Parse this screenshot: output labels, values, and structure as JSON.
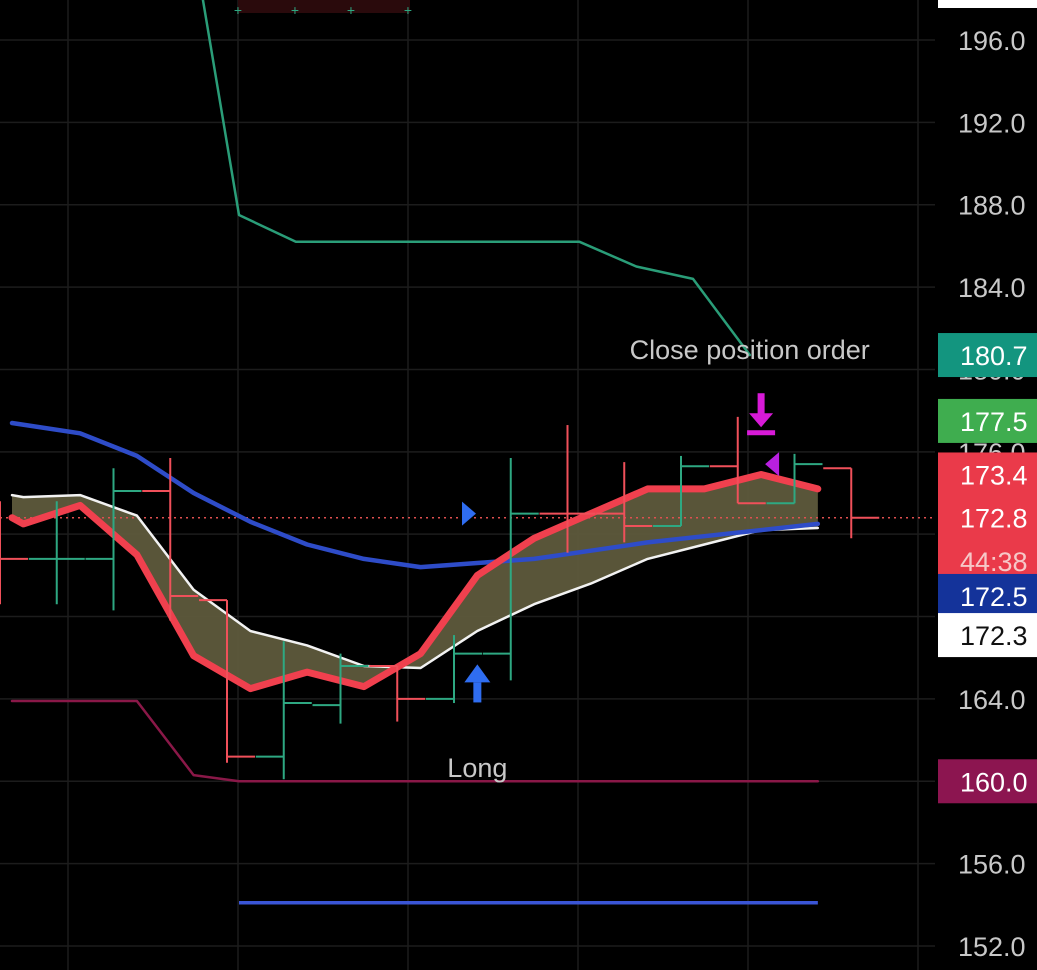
{
  "chart_data": {
    "type": "line",
    "ylim": [
      150.5,
      197.5
    ],
    "x_count": 15,
    "y_ticks": [
      {
        "value": 196,
        "label": "196.0"
      },
      {
        "value": 192,
        "label": "192.0"
      },
      {
        "value": 188,
        "label": "188.0"
      },
      {
        "value": 184,
        "label": "184.0"
      },
      {
        "value": 164,
        "label": "164.0"
      },
      {
        "value": 156,
        "label": "156.0"
      },
      {
        "value": 152,
        "label": "152.0"
      }
    ],
    "partial_ticks": [
      {
        "value": 180,
        "label": "180.0"
      },
      {
        "value": 176,
        "label": "176.0"
      }
    ],
    "bars": [
      {
        "x": 0,
        "open": 173.6,
        "high": 173.6,
        "low": 168.6,
        "close": 170.8,
        "color": "#f0505a"
      },
      {
        "x": 1,
        "open": 170.8,
        "high": 173.6,
        "low": 168.6,
        "close": 170.8,
        "color": "#2ea882"
      },
      {
        "x": 2,
        "open": 170.8,
        "high": 175.2,
        "low": 168.3,
        "close": 174.1,
        "color": "#2ea882"
      },
      {
        "x": 3,
        "open": 174.1,
        "high": 175.7,
        "low": 167.8,
        "close": 169.0,
        "color": "#f0505a"
      },
      {
        "x": 4,
        "open": 168.8,
        "high": 168.8,
        "low": 160.9,
        "close": 161.2,
        "color": "#f0505a"
      },
      {
        "x": 5,
        "open": 161.2,
        "high": 166.8,
        "low": 160.1,
        "close": 163.8,
        "color": "#2ea882"
      },
      {
        "x": 6,
        "open": 163.7,
        "high": 166.2,
        "low": 162.8,
        "close": 165.6,
        "color": "#2ea882"
      },
      {
        "x": 7,
        "open": 165.6,
        "high": 165.6,
        "low": 162.9,
        "close": 164.0,
        "color": "#f0505a"
      },
      {
        "x": 8,
        "open": 164.0,
        "high": 167.1,
        "low": 163.8,
        "close": 166.2,
        "color": "#2ea882"
      },
      {
        "x": 9,
        "open": 166.2,
        "high": 175.7,
        "low": 164.9,
        "close": 173.0,
        "color": "#2ea882"
      },
      {
        "x": 10,
        "open": 173.0,
        "high": 177.3,
        "low": 171.1,
        "close": 173.0,
        "color": "#f0505a"
      },
      {
        "x": 11,
        "open": 173.0,
        "high": 175.5,
        "low": 171.6,
        "close": 172.4,
        "color": "#f0505a"
      },
      {
        "x": 12,
        "open": 172.4,
        "high": 175.8,
        "low": 172.4,
        "close": 175.3,
        "color": "#2ea882"
      },
      {
        "x": 13,
        "open": 175.3,
        "high": 177.7,
        "low": 173.5,
        "close": 173.5,
        "color": "#f0505a"
      },
      {
        "x": 14,
        "open": 173.5,
        "high": 175.9,
        "low": 173.5,
        "close": 175.4,
        "color": "#2ea882"
      },
      {
        "x": 15,
        "open": 175.2,
        "high": 175.2,
        "low": 171.8,
        "close": 172.8,
        "color": "#f0505a"
      }
    ],
    "series": [
      {
        "key": "upper_band",
        "color": "#2a9d78",
        "width": 2.5,
        "points": [
          [
            3.3,
            199
          ],
          [
            4.0,
            187.5
          ],
          [
            5.0,
            186.2
          ],
          [
            6.0,
            186.2
          ],
          [
            7.0,
            186.2
          ],
          [
            8.0,
            186.2
          ],
          [
            9.0,
            186.2
          ],
          [
            10.0,
            186.2
          ],
          [
            11.0,
            185.0
          ],
          [
            12.0,
            184.4
          ],
          [
            13.0,
            180.7
          ]
        ]
      },
      {
        "key": "lower_band",
        "color": "#8a1848",
        "width": 2.5,
        "points": [
          [
            0,
            163.9
          ],
          [
            2.2,
            163.9
          ],
          [
            3.2,
            160.3
          ],
          [
            4.0,
            160.0
          ],
          [
            14.2,
            160.0
          ]
        ]
      },
      {
        "key": "fast_ma",
        "color": "#f0404e",
        "width": 7,
        "points": [
          [
            0,
            172.8
          ],
          [
            0.2,
            172.5
          ],
          [
            1.2,
            173.4
          ],
          [
            2.2,
            171.0
          ],
          [
            3.2,
            166.1
          ],
          [
            4.2,
            164.5
          ],
          [
            5.2,
            165.3
          ],
          [
            6.2,
            164.6
          ],
          [
            7.2,
            166.2
          ],
          [
            8.2,
            170.0
          ],
          [
            9.2,
            171.8
          ],
          [
            10.2,
            173.0
          ],
          [
            11.2,
            174.2
          ],
          [
            12.2,
            174.2
          ],
          [
            13.2,
            174.9
          ],
          [
            14.2,
            174.2
          ]
        ]
      },
      {
        "key": "slow_ma",
        "color": "#2e4cc8",
        "width": 4.5,
        "points": [
          [
            0,
            177.4
          ],
          [
            1.2,
            176.9
          ],
          [
            2.2,
            175.8
          ],
          [
            3.2,
            174.0
          ],
          [
            4.2,
            172.6
          ],
          [
            5.2,
            171.5
          ],
          [
            6.2,
            170.8
          ],
          [
            7.2,
            170.4
          ],
          [
            8.2,
            170.6
          ],
          [
            9.2,
            170.8
          ],
          [
            10.2,
            171.2
          ],
          [
            11.2,
            171.6
          ],
          [
            12.2,
            171.9
          ],
          [
            13.2,
            172.2
          ],
          [
            14.2,
            172.5
          ]
        ]
      },
      {
        "key": "white_ma",
        "color": "#f2f2f2",
        "width": 2.5,
        "points": [
          [
            0,
            173.9
          ],
          [
            0.2,
            173.8
          ],
          [
            1.2,
            173.9
          ],
          [
            2.2,
            172.9
          ],
          [
            3.2,
            169.3
          ],
          [
            4.2,
            167.3
          ],
          [
            5.2,
            166.6
          ],
          [
            6.2,
            165.6
          ],
          [
            7.2,
            165.5
          ],
          [
            8.2,
            167.3
          ],
          [
            9.2,
            168.6
          ],
          [
            10.2,
            169.6
          ],
          [
            11.2,
            170.8
          ],
          [
            12.2,
            171.5
          ],
          [
            13.2,
            172.2
          ],
          [
            14.2,
            172.3
          ]
        ]
      }
    ],
    "support_line": {
      "value": 154.1,
      "x_from": 4.0,
      "x_to": 14.2,
      "color": "#3a55d6"
    },
    "current_price_line": {
      "value": 172.8,
      "color": "#e05050"
    },
    "annotations": [
      {
        "text": "Close position order",
        "x": 13.0,
        "y": 181.0,
        "color": "#c8c8c8"
      },
      {
        "text": "Long",
        "x": 8.2,
        "y": 160.7,
        "color": "#c8c8c8"
      }
    ],
    "markers": {
      "long_arrow": {
        "x": 8.2,
        "y": 164.8,
        "color": "#2f6df0"
      },
      "close_arrow": {
        "x": 13.2,
        "y": 177.0,
        "color": "#d81ad8"
      },
      "buy_flag": {
        "x": 8.0,
        "y": 173.0,
        "color": "#2f6df0"
      },
      "sell_flag": {
        "x": 13.2,
        "y": 175.4,
        "color": "#b820e0"
      }
    },
    "price_badges": [
      {
        "label": "180.7",
        "value": 180.7,
        "bg": "#13957f",
        "fg": "#ffffff"
      },
      {
        "label": "177.5",
        "value": 177.5,
        "bg": "#3fad4f",
        "fg": "#ffffff"
      },
      {
        "label": "173.4",
        "value": 174.9,
        "bg": "#ea3a4a",
        "fg": "#ffffff"
      },
      {
        "label": "172.8",
        "value": 172.8,
        "bg": "#ea3a4a",
        "fg": "#ffffff"
      },
      {
        "label": "44:38",
        "value": 170.7,
        "bg": "#ea3a4a",
        "fg": "#f6c8c8"
      },
      {
        "label": "172.5",
        "value": 169.0,
        "bg": "#14339a",
        "fg": "#ffffff"
      },
      {
        "label": "172.3",
        "value": 167.1,
        "bg": "#ffffff",
        "fg": "#111111"
      },
      {
        "label": "160.0",
        "value": 160.0,
        "bg": "#8c1550",
        "fg": "#ffffff"
      }
    ]
  }
}
